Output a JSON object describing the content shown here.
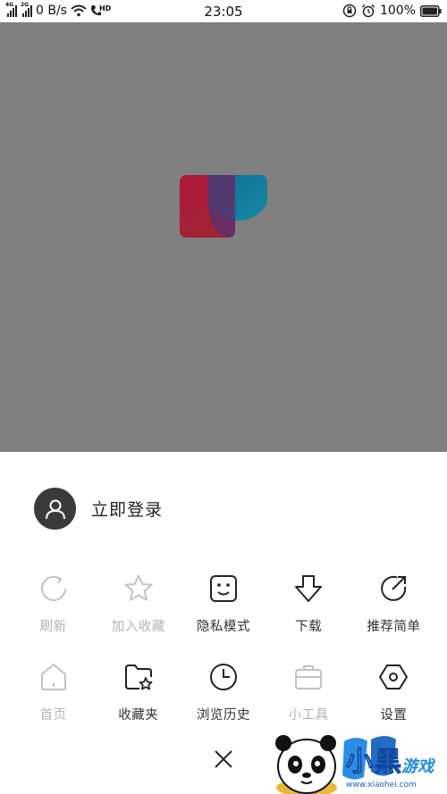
{
  "status_bar": {
    "net_4g": "4G",
    "net_2g": "2G",
    "speed": "0 B/s",
    "hd": "HD",
    "time": "23:05",
    "battery": "100%"
  },
  "splash": {
    "background": "#808080",
    "logo_colors": [
      "#b0173f",
      "#0a7ea5"
    ]
  },
  "account": {
    "login_label": "立即登录",
    "icon": "user-icon"
  },
  "menu": {
    "row1": [
      {
        "label": "刷新",
        "icon": "refresh-icon",
        "enabled": false
      },
      {
        "label": "加入收藏",
        "icon": "star-icon",
        "enabled": false
      },
      {
        "label": "隐私模式",
        "icon": "private-face-icon",
        "enabled": true
      },
      {
        "label": "下载",
        "icon": "download-arrow-icon",
        "enabled": true
      },
      {
        "label": "推荐简单",
        "icon": "share-icon",
        "enabled": true
      }
    ],
    "row2": [
      {
        "label": "首页",
        "icon": "home-icon",
        "enabled": false
      },
      {
        "label": "收藏夹",
        "icon": "favorites-folder-icon",
        "enabled": true
      },
      {
        "label": "浏览历史",
        "icon": "clock-icon",
        "enabled": true
      },
      {
        "label": "小工具",
        "icon": "toolbox-icon",
        "enabled": false
      },
      {
        "label": "设置",
        "icon": "settings-hexagon-icon",
        "enabled": true
      }
    ]
  },
  "close_icon": "close-icon",
  "watermark": {
    "brand": "小黑",
    "sub": "游戏",
    "url": "www.xiaohei.com"
  }
}
